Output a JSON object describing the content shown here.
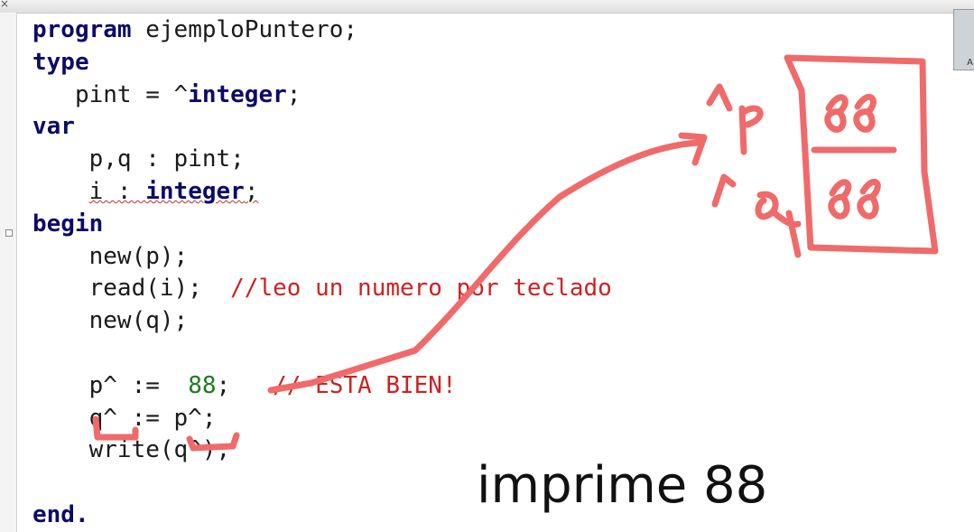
{
  "code_lines": [
    [
      {
        "t": "program",
        "c": "kw"
      },
      {
        "t": " ejemploPuntero;"
      }
    ],
    [
      {
        "t": "type",
        "c": "kw"
      }
    ],
    [
      {
        "t": "   pint = ^"
      },
      {
        "t": "integer",
        "c": "kw"
      },
      {
        "t": ";"
      }
    ],
    [
      {
        "t": "var",
        "c": "kw"
      }
    ],
    [
      {
        "t": "    p,q : pint;"
      }
    ],
    [
      {
        "t": "    "
      },
      {
        "t": "i : ",
        "c": "squiggle"
      },
      {
        "t": "integer",
        "c": "kw squiggle"
      },
      {
        "t": ";",
        "c": "squiggle"
      }
    ],
    [
      {
        "t": "begin",
        "c": "kw"
      }
    ],
    [
      {
        "t": "    new(p);"
      }
    ],
    [
      {
        "t": "    read(i);  "
      },
      {
        "t": "//leo un numero por teclado",
        "c": "cm"
      }
    ],
    [
      {
        "t": "    new(q);"
      }
    ],
    [
      {
        "t": ""
      }
    ],
    [
      {
        "t": "    p^ :=  "
      },
      {
        "t": "88",
        "c": "num"
      },
      {
        "t": ";   "
      },
      {
        "t": "// ESTA BIEN!",
        "c": "cm"
      }
    ],
    [
      {
        "t": "    q^ := p^;"
      }
    ],
    [
      {
        "t": "    write(q^);"
      }
    ],
    [
      {
        "t": ""
      }
    ],
    [
      {
        "t": "end.",
        "c": "kw"
      }
    ]
  ],
  "caption": "imprime 88",
  "annotations": {
    "box_top_value": "88",
    "box_bottom_value": "88",
    "label_p": "^p",
    "label_q": "^q"
  },
  "window": {
    "close_glyph": "×",
    "webcam_label": "A"
  },
  "colors": {
    "ink": "#f06a6a",
    "keyword": "#0b0b6b",
    "comment": "#d02020",
    "number": "#1f7a1f"
  }
}
